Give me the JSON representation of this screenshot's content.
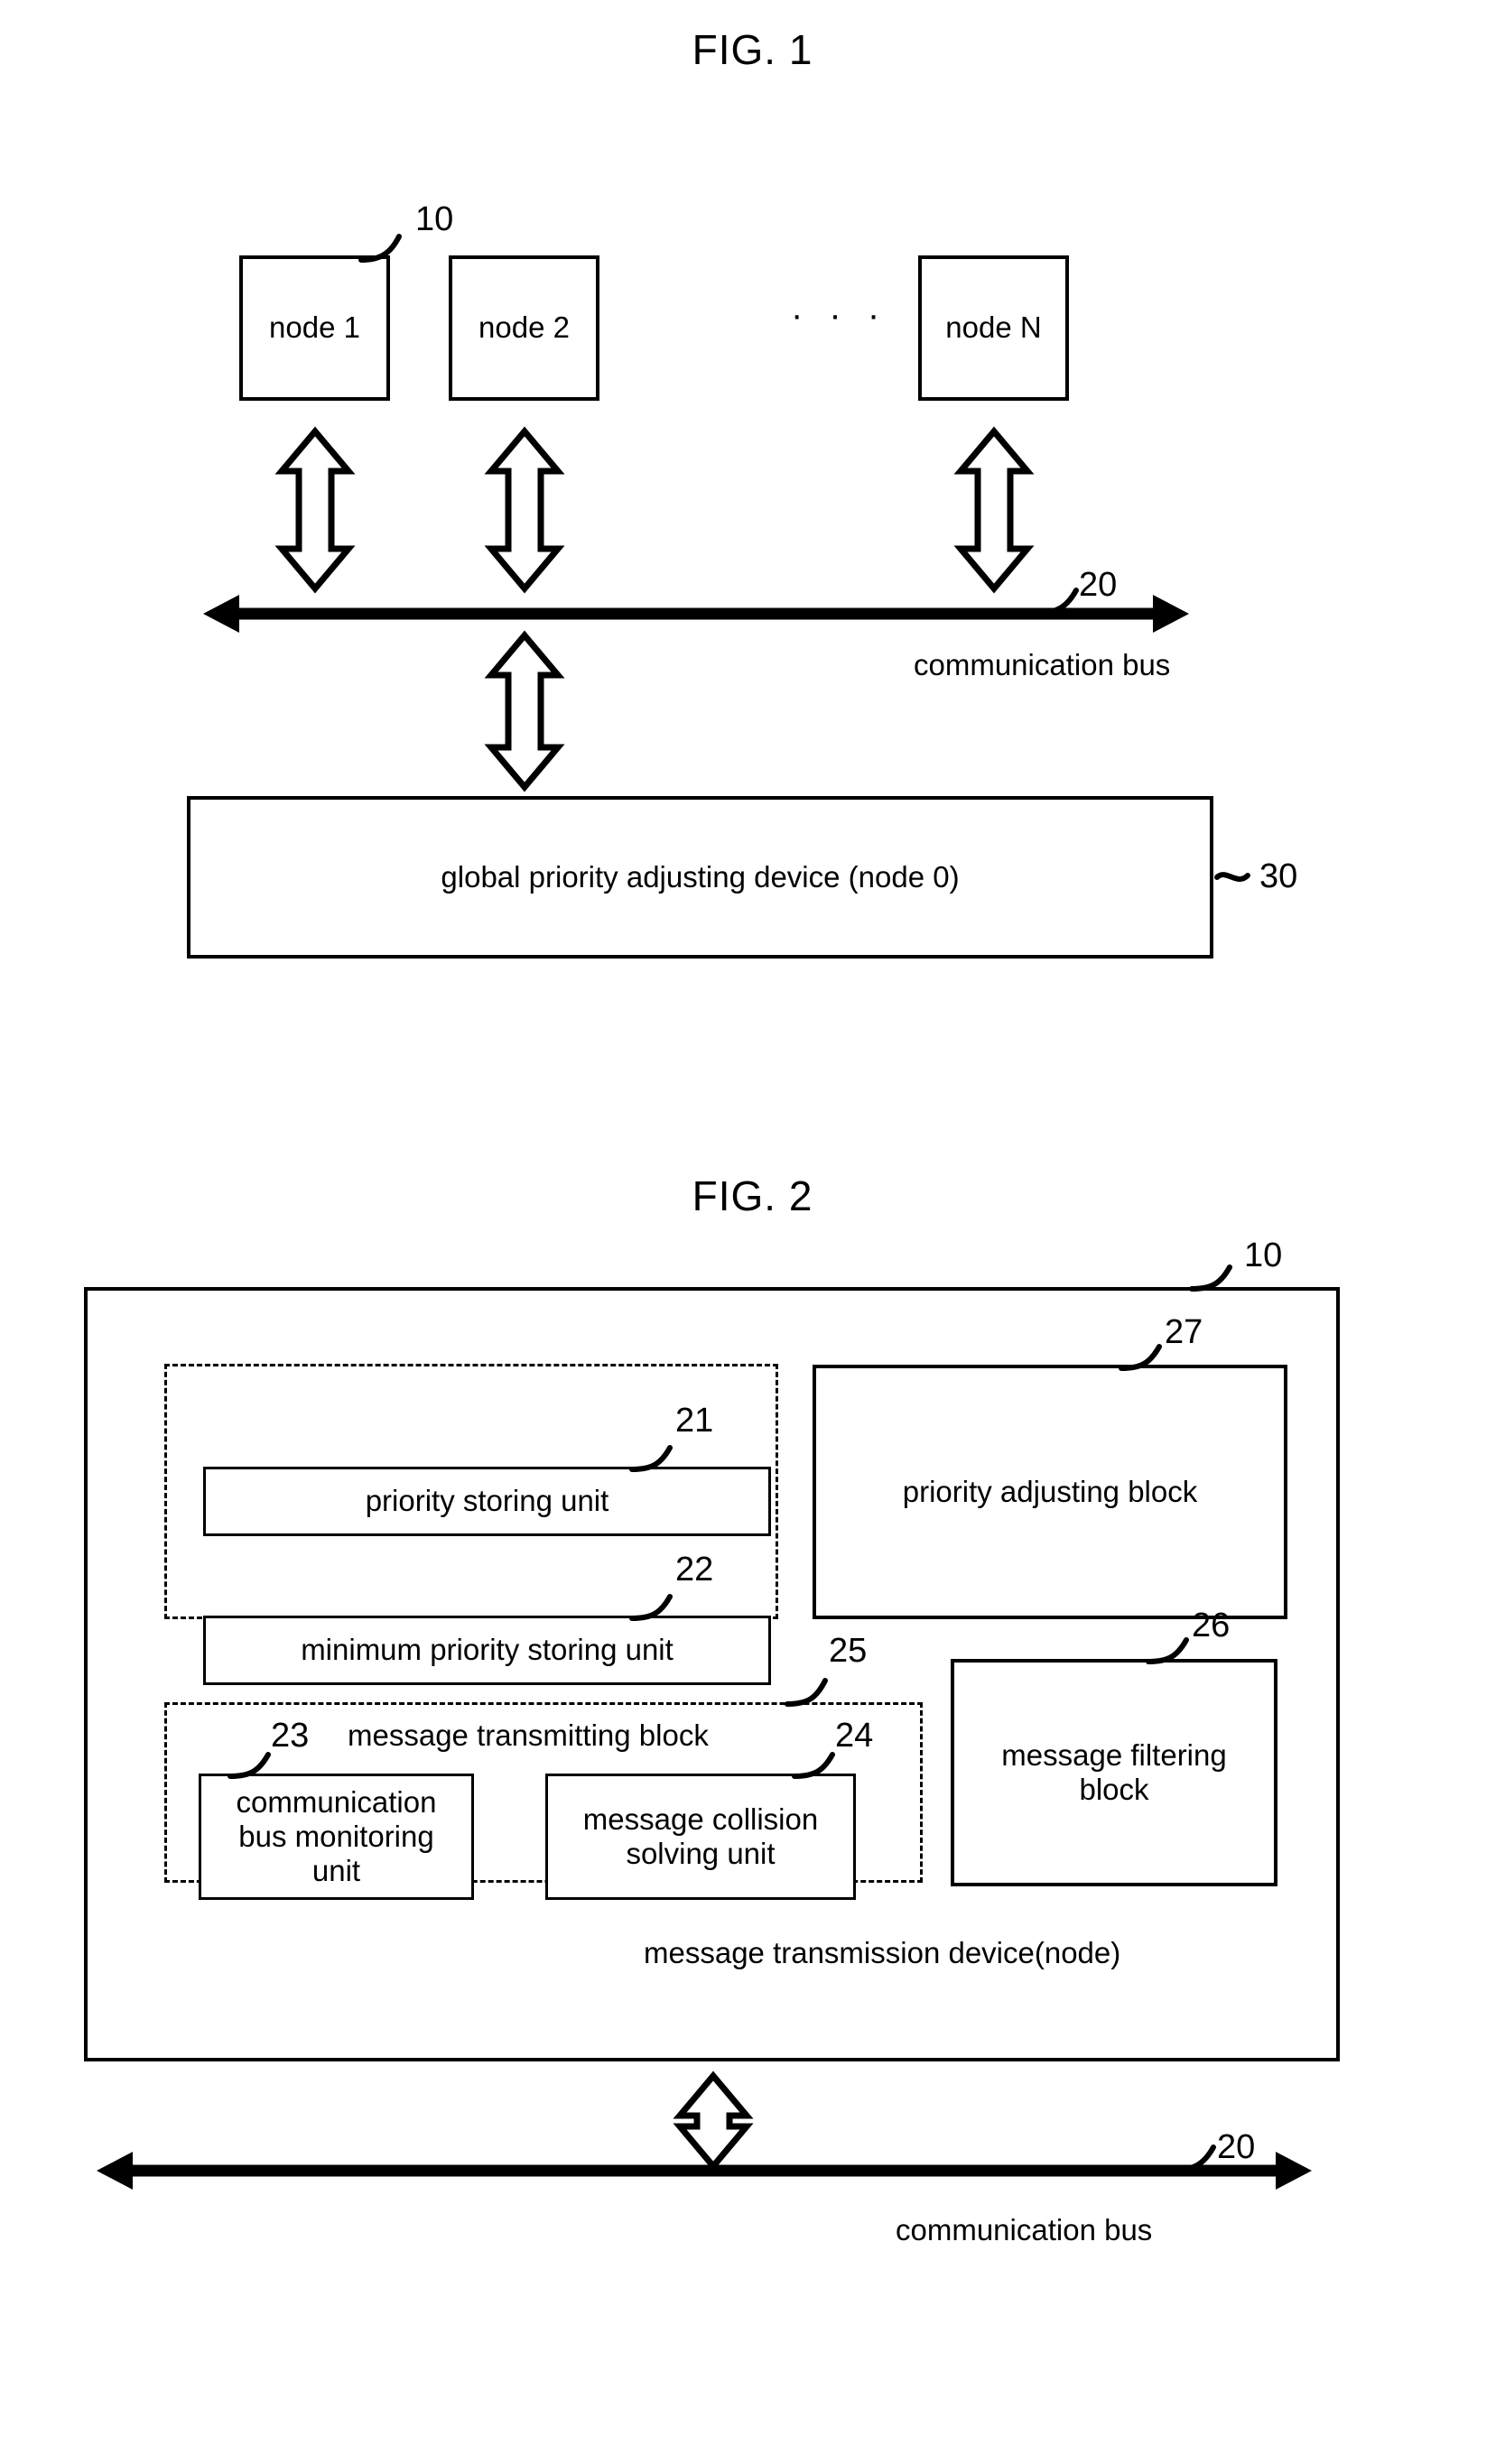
{
  "figures": [
    {
      "title": "FIG. 1",
      "refs": {
        "node_block": "10",
        "bus": "20",
        "global_device": "30"
      },
      "nodes": [
        {
          "label": "node 1"
        },
        {
          "label": "node 2"
        },
        {
          "label": "node N"
        }
      ],
      "ellipsis": "· · ·",
      "bus_label": "communication bus",
      "global_device_label": "global priority adjusting device (node 0)"
    },
    {
      "title": "FIG. 2",
      "refs": {
        "device": "10",
        "priority_storing_unit": "21",
        "minimum_priority_storing_unit": "22",
        "communication_bus_monitoring_unit": "23",
        "message_collision_solving_unit": "24",
        "message_transmitting_block": "25",
        "message_filtering_block": "26",
        "priority_adjusting_block": "27",
        "bus": "20"
      },
      "blocks": {
        "priority_storing_unit": "priority storing unit",
        "minimum_priority_storing_unit": "minimum priority storing unit",
        "priority_adjusting_block": "priority adjusting block",
        "message_transmitting_block": "message transmitting block",
        "communication_bus_monitoring_unit": "communication\nbus monitoring\nunit",
        "message_collision_solving_unit": "message collision\nsolving unit",
        "message_filtering_block": "message filtering\nblock",
        "device_label": "message transmission device(node)"
      },
      "bus_label": "communication bus"
    }
  ],
  "colors": {
    "ink": "#000000",
    "paper": "#ffffff"
  }
}
